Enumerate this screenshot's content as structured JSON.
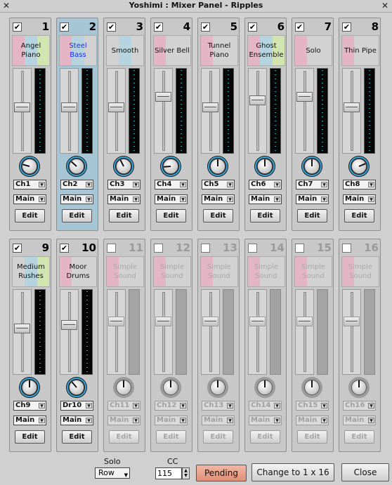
{
  "window": {
    "title": "Yoshimi : Mixer Panel - Ripples",
    "left_icon": "✕",
    "right_icon": "✕"
  },
  "colors": {
    "band_pink": "#e4b5c4",
    "band_blue": "#b5d4e0",
    "band_green": "#d2e5b0",
    "active_strip": "#a6c6d5",
    "meter_tick": "#1da5b8"
  },
  "parts": [
    {
      "num": "1",
      "checked": true,
      "name_line1": "Angel",
      "name_line2": "Piano",
      "bands": [
        "pink",
        "blue",
        "green"
      ],
      "channel": "Ch1",
      "output": "Main",
      "edit": "Edit",
      "fader": 0.55,
      "pan": -0.55,
      "active": false,
      "enabled": true
    },
    {
      "num": "2",
      "checked": true,
      "name_line1": "Steel Bass",
      "name_line2": "",
      "bands": [
        "pink",
        "blue",
        "none"
      ],
      "channel": "Ch2",
      "output": "Main",
      "edit": "Edit",
      "fader": 0.55,
      "pan": -0.35,
      "active": true,
      "enabled": true,
      "blue_label": true
    },
    {
      "num": "3",
      "checked": true,
      "name_line1": "Smooth",
      "name_line2": "",
      "bands": [
        "none",
        "blue",
        "none"
      ],
      "channel": "Ch3",
      "output": "Main",
      "edit": "Edit",
      "fader": 0.55,
      "pan": -0.2,
      "active": false,
      "enabled": true
    },
    {
      "num": "4",
      "checked": true,
      "name_line1": "Silver Bell",
      "name_line2": "",
      "bands": [
        "pink",
        "none",
        "none"
      ],
      "channel": "Ch4",
      "output": "Main",
      "edit": "Edit",
      "fader": 0.7,
      "pan": -0.7,
      "active": false,
      "enabled": true
    },
    {
      "num": "5",
      "checked": true,
      "name_line1": "Tunnel",
      "name_line2": "Piano",
      "bands": [
        "pink",
        "none",
        "none"
      ],
      "channel": "Ch5",
      "output": "Main",
      "edit": "Edit",
      "fader": 0.55,
      "pan": 0.0,
      "active": false,
      "enabled": true
    },
    {
      "num": "6",
      "checked": true,
      "name_line1": "Ghost",
      "name_line2": "Ensemble",
      "bands": [
        "pink",
        "blue",
        "green"
      ],
      "channel": "Ch6",
      "output": "Main",
      "edit": "Edit",
      "fader": 0.65,
      "pan": 0.0,
      "active": false,
      "enabled": true
    },
    {
      "num": "7",
      "checked": true,
      "name_line1": "Solo",
      "name_line2": "",
      "bands": [
        "pink",
        "none",
        "none"
      ],
      "channel": "Ch7",
      "output": "Main",
      "edit": "Edit",
      "fader": 0.7,
      "pan": 0.0,
      "active": false,
      "enabled": true
    },
    {
      "num": "8",
      "checked": true,
      "name_line1": "Thin Pipe",
      "name_line2": "",
      "bands": [
        "pink",
        "none",
        "none"
      ],
      "channel": "Ch8",
      "output": "Main",
      "edit": "Edit",
      "fader": 0.55,
      "pan": 0.5,
      "active": false,
      "enabled": true
    },
    {
      "num": "9",
      "checked": true,
      "name_line1": "Medium",
      "name_line2": "Rushes",
      "bands": [
        "none",
        "blue",
        "green"
      ],
      "channel": "Ch9",
      "output": "Main",
      "edit": "Edit",
      "fader": 0.55,
      "pan": 0.0,
      "active": false,
      "enabled": true
    },
    {
      "num": "10",
      "checked": true,
      "name_line1": "Moor",
      "name_line2": "Drums",
      "bands": [
        "pink",
        "none",
        "none"
      ],
      "channel": "Dr10",
      "output": "Main",
      "edit": "Edit",
      "fader": 0.6,
      "pan": -0.3,
      "active": false,
      "enabled": true
    },
    {
      "num": "11",
      "checked": false,
      "name_line1": "Simple",
      "name_line2": "Sound",
      "bands": [
        "pink",
        "none",
        "none"
      ],
      "channel": "Ch11",
      "output": "Main",
      "edit": "Edit",
      "fader": 0.65,
      "pan": 0.0,
      "active": false,
      "enabled": false
    },
    {
      "num": "12",
      "checked": false,
      "name_line1": "Simple",
      "name_line2": "Sound",
      "bands": [
        "pink",
        "none",
        "none"
      ],
      "channel": "Ch12",
      "output": "Main",
      "edit": "Edit",
      "fader": 0.65,
      "pan": 0.0,
      "active": false,
      "enabled": false
    },
    {
      "num": "13",
      "checked": false,
      "name_line1": "Simple",
      "name_line2": "Sound",
      "bands": [
        "pink",
        "none",
        "none"
      ],
      "channel": "Ch13",
      "output": "Main",
      "edit": "Edit",
      "fader": 0.65,
      "pan": 0.0,
      "active": false,
      "enabled": false
    },
    {
      "num": "14",
      "checked": false,
      "name_line1": "Simple",
      "name_line2": "Sound",
      "bands": [
        "pink",
        "none",
        "none"
      ],
      "channel": "Ch14",
      "output": "Main",
      "edit": "Edit",
      "fader": 0.65,
      "pan": 0.0,
      "active": false,
      "enabled": false
    },
    {
      "num": "15",
      "checked": false,
      "name_line1": "Simple",
      "name_line2": "Sound",
      "bands": [
        "pink",
        "none",
        "none"
      ],
      "channel": "Ch15",
      "output": "Main",
      "edit": "Edit",
      "fader": 0.65,
      "pan": 0.0,
      "active": false,
      "enabled": false
    },
    {
      "num": "16",
      "checked": false,
      "name_line1": "Simple",
      "name_line2": "Sound",
      "bands": [
        "pink",
        "none",
        "none"
      ],
      "channel": "Ch16",
      "output": "Main",
      "edit": "Edit",
      "fader": 0.65,
      "pan": 0.0,
      "active": false,
      "enabled": false
    }
  ],
  "footer": {
    "solo_label": "Solo",
    "solo_value": "Row",
    "cc_label": "CC",
    "cc_value": "115",
    "pending_label": "Pending",
    "change_label": "Change to 1 x 16",
    "close_label": "Close"
  }
}
